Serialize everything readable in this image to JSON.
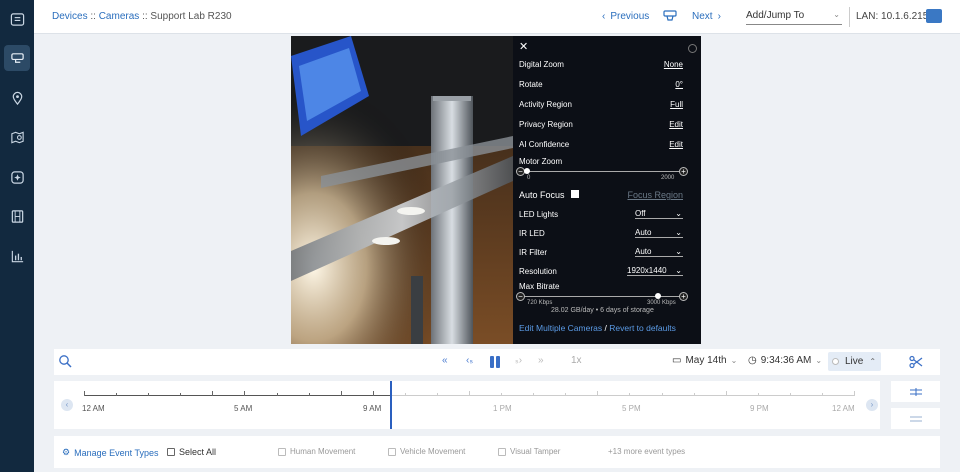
{
  "sidebar": {
    "icons": [
      "grid-icon",
      "camera-list-icon",
      "location-pin-icon",
      "map-search-icon",
      "event-icon",
      "film-icon",
      "chart-icon"
    ]
  },
  "topbar": {
    "breadcrumb": {
      "devices": "Devices",
      "sep": "::",
      "cameras": "Cameras",
      "current": "Support Lab R230"
    },
    "previous": "Previous",
    "next": "Next",
    "jump_to": "Add/Jump To",
    "lan": "LAN: 10.1.6.215"
  },
  "settings": {
    "digital_zoom_label": "Digital Zoom",
    "digital_zoom_value": "None",
    "rotate_label": "Rotate",
    "rotate_value": "0°",
    "activity_region_label": "Activity Region",
    "activity_region_value": "Full",
    "privacy_region_label": "Privacy Region",
    "privacy_region_value": "Edit",
    "ai_confidence_label": "AI Confidence",
    "ai_confidence_value": "Edit",
    "motor_zoom_label": "Motor Zoom",
    "motor_zoom_min": "0",
    "motor_zoom_max": "2000",
    "auto_focus_label": "Auto Focus",
    "focus_region_label": "Focus Region",
    "led_lights_label": "LED Lights",
    "led_lights_value": "Off",
    "ir_led_label": "IR LED",
    "ir_led_value": "Auto",
    "ir_filter_label": "IR Filter",
    "ir_filter_value": "Auto",
    "resolution_label": "Resolution",
    "resolution_value": "1920x1440",
    "max_bitrate_label": "Max Bitrate",
    "bitrate_min": "720 Kbps",
    "bitrate_max": "3000 Kbps",
    "storage_info": "28.02 GB/day • 6 days of storage",
    "edit_multiple": "Edit Multiple Cameras",
    "link_sep": "/",
    "revert": "Revert to defaults"
  },
  "controls": {
    "speed": "1x",
    "date": "May 14th",
    "time": "9:34:36 AM",
    "live": "Live"
  },
  "timeline": {
    "labels": [
      "12 AM",
      "5 AM",
      "9 AM",
      "1 PM",
      "5 PM",
      "9 PM",
      "12 AM"
    ]
  },
  "events": {
    "manage": "Manage Event Types",
    "select_all": "Select All",
    "human": "Human Movement",
    "vehicle": "Vehicle Movement",
    "tamper": "Visual Tamper",
    "more": "+13 more event types"
  },
  "colors": {
    "sidebar": "#12293f",
    "accent": "#2a6ebd",
    "cursor": "#2a5fbf"
  }
}
